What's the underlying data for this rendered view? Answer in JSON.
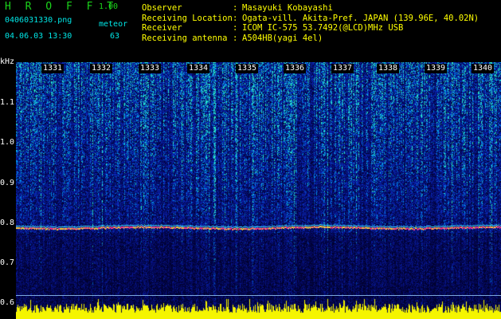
{
  "header": {
    "app_title": "H R O F F T",
    "version": "1.00",
    "filename": "0406031330.png",
    "mode": "meteor",
    "datetime": "04.06.03 13:30",
    "count": "63"
  },
  "info": [
    {
      "key": "Observer",
      "value": "Masayuki Kobayashi"
    },
    {
      "key": "Receiving Location",
      "value": "Ogata-vill. Akita-Pref. JAPAN (139.96E, 40.02N)"
    },
    {
      "key": "Receiver",
      "value": "ICOM IC-575 53.7492(@LCD)MHz USB"
    },
    {
      "key": "Receiving antenna",
      "value": "A504HB(yagi 4el)"
    }
  ],
  "y_axis": {
    "unit": "kHz",
    "ticks": [
      "1.1",
      "1.0",
      "0.9",
      "0.8",
      "0.7",
      "0.6"
    ],
    "range": [
      0.6,
      1.15
    ]
  },
  "time_labels": [
    "1331",
    "1332",
    "1333",
    "1334",
    "1335",
    "1336",
    "1337",
    "1338",
    "1339",
    "1340"
  ],
  "signal": {
    "carrier_khz": 0.76
  },
  "colors": {
    "title_green": "#1bd41b",
    "info_yellow": "#ffff00",
    "carrier": "#ff3b8a"
  }
}
